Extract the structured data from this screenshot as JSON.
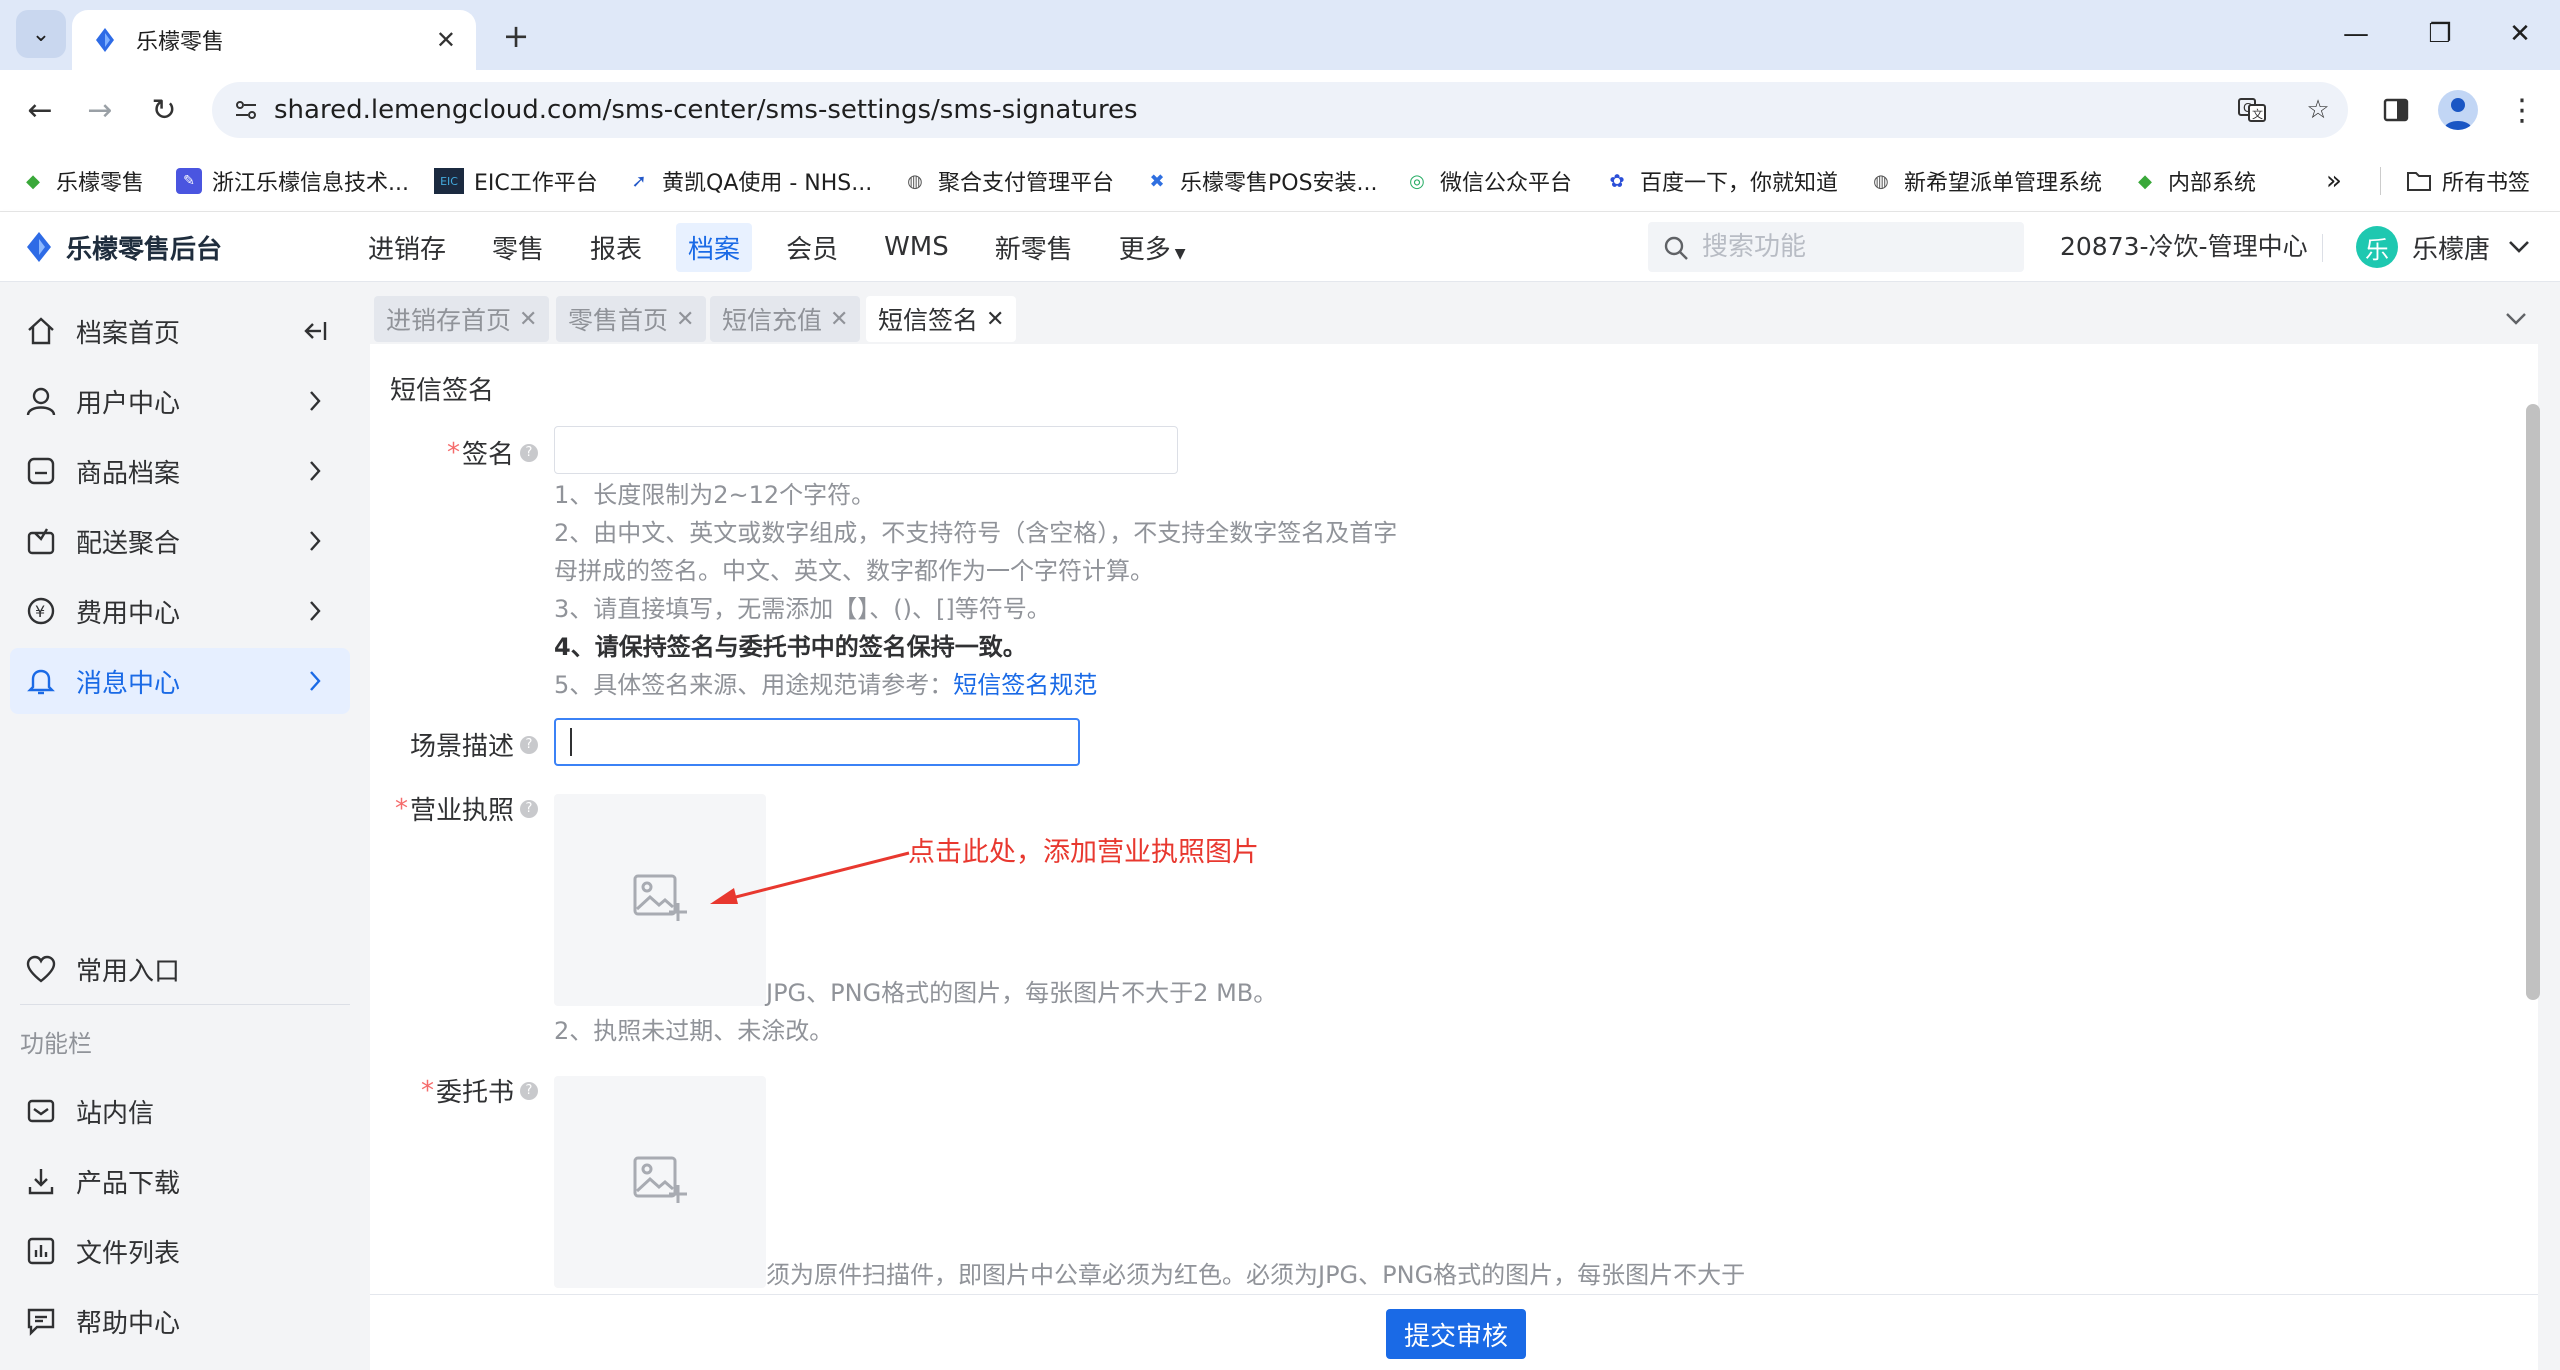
{
  "browser": {
    "tab_title": "乐檬零售",
    "url": "shared.lemengcloud.com/sms-center/sms-settings/sms-signatures",
    "bookmarks": [
      {
        "label": "乐檬零售"
      },
      {
        "label": "浙江乐檬信息技术..."
      },
      {
        "label": "EIC工作平台"
      },
      {
        "label": "黄凯QA使用 - NHS..."
      },
      {
        "label": "聚合支付管理平台"
      },
      {
        "label": "乐檬零售POS安装..."
      },
      {
        "label": "微信公众平台"
      },
      {
        "label": "百度一下，你就知道"
      },
      {
        "label": "新希望派单管理系统"
      },
      {
        "label": "内部系统"
      }
    ],
    "all_bookmarks": "所有书签"
  },
  "header": {
    "logo_text": "乐檬零售后台",
    "nav": [
      {
        "label": "进销存"
      },
      {
        "label": "零售"
      },
      {
        "label": "报表"
      },
      {
        "label": "档案"
      },
      {
        "label": "会员"
      },
      {
        "label": "WMS"
      },
      {
        "label": "新零售"
      },
      {
        "label": "更多"
      }
    ],
    "search_placeholder": "搜索功能",
    "org": "20873-冷饮-管理中心",
    "user_avatar": "乐",
    "user_name": "乐檬唐"
  },
  "sidebar": {
    "items": [
      {
        "label": "档案首页"
      },
      {
        "label": "用户中心"
      },
      {
        "label": "商品档案"
      },
      {
        "label": "配送聚合"
      },
      {
        "label": "费用中心"
      },
      {
        "label": "消息中心"
      }
    ],
    "favorites": "常用入口",
    "group_title": "功能栏",
    "tools": [
      {
        "label": "站内信"
      },
      {
        "label": "产品下载"
      },
      {
        "label": "文件列表"
      },
      {
        "label": "帮助中心"
      }
    ]
  },
  "page_tabs": [
    {
      "label": "进销存首页"
    },
    {
      "label": "零售首页"
    },
    {
      "label": "短信充值"
    },
    {
      "label": "短信签名"
    }
  ],
  "form": {
    "title": "短信签名",
    "signature_label": "签名",
    "signature_value": "",
    "signature_hints": [
      "1、长度限制为2~12个字符。",
      "2、由中文、英文或数字组成，不支持符号（含空格），不支持全数字签名及首字",
      "母拼成的签名。中文、英文、数字都作为一个字符计算。",
      "3、请直接填写，无需添加【】、()、[]等符号。",
      "4、请保持签名与委托书中的签名保持一致。",
      "5、具体签名来源、用途规范请参考："
    ],
    "spec_link": "短信签名规范",
    "scene_label": "场景描述",
    "scene_value": "",
    "license_label": "营业执照",
    "license_hints": [
      "JPG、PNG格式的图片，每张图片不大于2 MB。",
      "2、执照未过期、未涂改。"
    ],
    "proxy_label": "委托书",
    "proxy_hint": "须为原件扫描件，即图片中公章必须为红色。必须为JPG、PNG格式的图片，每张图片不大于",
    "annotation": "点击此处，添加营业执照图片",
    "submit_label": "提交审核"
  },
  "colors": {
    "primary": "#1a6ae6",
    "annotation": "#e8382f",
    "required": "#f56c6c"
  }
}
